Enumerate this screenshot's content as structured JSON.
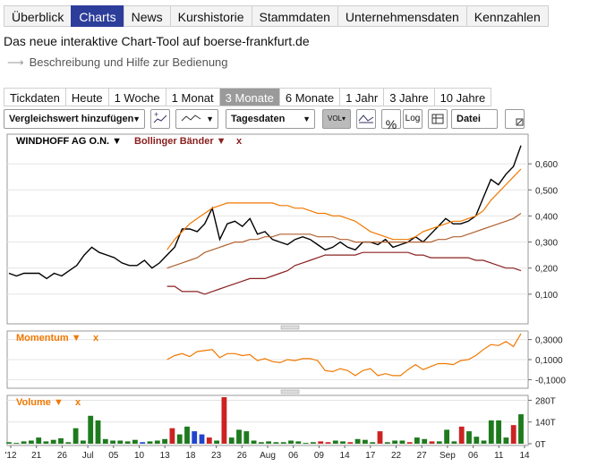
{
  "nav": {
    "tabs": [
      {
        "label": "Überblick",
        "active": false
      },
      {
        "label": "Charts",
        "active": true
      },
      {
        "label": "News",
        "active": false
      },
      {
        "label": "Kurshistorie",
        "active": false
      },
      {
        "label": "Stammdaten",
        "active": false
      },
      {
        "label": "Unternehmensdaten",
        "active": false
      },
      {
        "label": "Kennzahlen",
        "active": false
      }
    ]
  },
  "intro_text": "Das neue interaktive Chart-Tool auf boerse-frankfurt.de",
  "help_link": "Beschreibung und Hilfe zur Bedienung",
  "periods": [
    "Tickdaten",
    "Heute",
    "1 Woche",
    "1 Monat",
    "3 Monate",
    "6 Monate",
    "1 Jahr",
    "3 Jahre",
    "10 Jahre"
  ],
  "active_period": "3 Monate",
  "toolbar": {
    "compare_label": "Vergleichswert hinzufügen",
    "data_select": "Tagesdaten",
    "vol_label": "VOL",
    "log_label": "Log",
    "percent_label": "%",
    "file_label": "Datei"
  },
  "colors": {
    "accent": "#2c3d9a",
    "price": "#000000",
    "band_orange": "#f07800",
    "band_dark": "#8b2020",
    "mid": "#b06030",
    "up": "#1e7a1e",
    "down": "#cc2222",
    "neutral": "#2244cc"
  },
  "chart_data": [
    {
      "type": "line",
      "panel": "price",
      "legend": [
        "WINDHOFF AG O.N.",
        "Bollinger Bänder"
      ],
      "close_label": "x",
      "ylim": [
        0,
        0.7
      ],
      "yticks": [
        "0,100",
        "0,200",
        "0,300",
        "0,400",
        "0,500",
        "0,600"
      ],
      "series": [
        {
          "name": "WINDHOFF AG O.N.",
          "values": [
            0.18,
            0.17,
            0.18,
            0.18,
            0.18,
            0.16,
            0.18,
            0.17,
            0.19,
            0.21,
            0.25,
            0.28,
            0.26,
            0.25,
            0.24,
            0.22,
            0.21,
            0.21,
            0.23,
            0.2,
            0.22,
            0.25,
            0.28,
            0.35,
            0.35,
            0.34,
            0.37,
            0.43,
            0.31,
            0.37,
            0.38,
            0.36,
            0.39,
            0.33,
            0.34,
            0.31,
            0.3,
            0.29,
            0.31,
            0.32,
            0.31,
            0.29,
            0.27,
            0.28,
            0.3,
            0.28,
            0.27,
            0.3,
            0.3,
            0.29,
            0.31,
            0.28,
            0.29,
            0.3,
            0.32,
            0.3,
            0.33,
            0.36,
            0.39,
            0.37,
            0.37,
            0.38,
            0.4,
            0.47,
            0.54,
            0.52,
            0.56,
            0.59,
            0.67
          ]
        },
        {
          "name": "Upper band",
          "values": [
            null,
            null,
            null,
            null,
            null,
            null,
            null,
            null,
            null,
            null,
            null,
            null,
            null,
            null,
            null,
            null,
            null,
            null,
            null,
            null,
            null,
            0.27,
            0.31,
            0.34,
            0.37,
            0.39,
            0.41,
            0.43,
            0.44,
            0.45,
            0.45,
            0.45,
            0.45,
            0.45,
            0.45,
            0.45,
            0.44,
            0.44,
            0.43,
            0.43,
            0.42,
            0.41,
            0.41,
            0.4,
            0.4,
            0.39,
            0.38,
            0.36,
            0.34,
            0.33,
            0.32,
            0.31,
            0.31,
            0.31,
            0.32,
            0.34,
            0.35,
            0.36,
            0.37,
            0.38,
            0.38,
            0.39,
            0.4,
            0.42,
            0.46,
            0.49,
            0.52,
            0.55,
            0.58
          ]
        },
        {
          "name": "Middle band",
          "values": [
            null,
            null,
            null,
            null,
            null,
            null,
            null,
            null,
            null,
            null,
            null,
            null,
            null,
            null,
            null,
            null,
            null,
            null,
            null,
            null,
            null,
            0.2,
            0.21,
            0.22,
            0.23,
            0.24,
            0.26,
            0.27,
            0.28,
            0.29,
            0.3,
            0.3,
            0.31,
            0.31,
            0.32,
            0.32,
            0.33,
            0.33,
            0.33,
            0.33,
            0.33,
            0.32,
            0.32,
            0.32,
            0.31,
            0.31,
            0.3,
            0.3,
            0.3,
            0.3,
            0.3,
            0.3,
            0.3,
            0.3,
            0.3,
            0.3,
            0.3,
            0.31,
            0.31,
            0.32,
            0.32,
            0.33,
            0.34,
            0.35,
            0.36,
            0.37,
            0.38,
            0.39,
            0.41
          ]
        },
        {
          "name": "Lower band",
          "values": [
            null,
            null,
            null,
            null,
            null,
            null,
            null,
            null,
            null,
            null,
            null,
            null,
            null,
            null,
            null,
            null,
            null,
            null,
            null,
            null,
            null,
            0.13,
            0.13,
            0.11,
            0.11,
            0.11,
            0.1,
            0.11,
            0.12,
            0.13,
            0.14,
            0.15,
            0.16,
            0.16,
            0.16,
            0.17,
            0.18,
            0.19,
            0.21,
            0.22,
            0.23,
            0.24,
            0.25,
            0.25,
            0.25,
            0.25,
            0.25,
            0.26,
            0.26,
            0.26,
            0.26,
            0.26,
            0.26,
            0.26,
            0.25,
            0.25,
            0.24,
            0.24,
            0.24,
            0.24,
            0.24,
            0.24,
            0.23,
            0.23,
            0.22,
            0.21,
            0.2,
            0.2,
            0.19
          ]
        }
      ]
    },
    {
      "type": "line",
      "panel": "momentum",
      "legend": [
        "Momentum"
      ],
      "close_label": "x",
      "ylim": [
        -0.15,
        0.35
      ],
      "yticks": [
        "-0,1000",
        "0,1000",
        "0,3000"
      ],
      "series": [
        {
          "name": "Momentum",
          "values": [
            null,
            null,
            null,
            null,
            null,
            null,
            null,
            null,
            null,
            null,
            null,
            null,
            null,
            null,
            null,
            null,
            null,
            null,
            null,
            null,
            null,
            0.1,
            0.14,
            0.16,
            0.13,
            0.18,
            0.19,
            0.2,
            0.12,
            0.16,
            0.16,
            0.14,
            0.15,
            0.09,
            0.11,
            0.08,
            0.07,
            0.1,
            0.09,
            0.11,
            0.11,
            0.09,
            -0.01,
            -0.02,
            0.01,
            -0.01,
            -0.06,
            -0.01,
            0.01,
            -0.06,
            -0.04,
            -0.06,
            -0.06,
            0.0,
            0.05,
            0.0,
            0.03,
            0.06,
            0.06,
            0.05,
            0.09,
            0.1,
            0.14,
            0.2,
            0.25,
            0.24,
            0.28,
            0.23,
            0.36
          ]
        }
      ]
    },
    {
      "type": "bar",
      "panel": "volume",
      "legend": [
        "Volume"
      ],
      "close_label": "x",
      "ylim": [
        0,
        300
      ],
      "yticks": [
        "0T",
        "140T",
        "280T"
      ],
      "values": [
        10,
        5,
        15,
        20,
        40,
        15,
        25,
        35,
        10,
        100,
        20,
        180,
        150,
        30,
        20,
        20,
        15,
        25,
        10,
        15,
        20,
        30,
        100,
        60,
        110,
        80,
        60,
        40,
        20,
        300,
        40,
        90,
        80,
        20,
        10,
        15,
        10,
        10,
        20,
        15,
        5,
        10,
        15,
        10,
        20,
        15,
        10,
        30,
        25,
        10,
        80,
        10,
        20,
        20,
        10,
        40,
        30,
        15,
        15,
        90,
        15,
        110,
        80,
        45,
        20,
        150,
        150,
        40,
        120,
        190
      ],
      "direction": [
        "u",
        "u",
        "u",
        "u",
        "u",
        "u",
        "u",
        "u",
        "u",
        "u",
        "u",
        "u",
        "u",
        "u",
        "u",
        "u",
        "u",
        "u",
        "n",
        "u",
        "u",
        "u",
        "d",
        "u",
        "u",
        "n",
        "n",
        "d",
        "u",
        "d",
        "u",
        "u",
        "u",
        "u",
        "u",
        "u",
        "u",
        "u",
        "u",
        "u",
        "u",
        "u",
        "d",
        "d",
        "u",
        "u",
        "d",
        "u",
        "u",
        "u",
        "d",
        "u",
        "u",
        "u",
        "d",
        "u",
        "u",
        "d",
        "u",
        "u",
        "u",
        "d",
        "u",
        "u",
        "u",
        "u",
        "u",
        "u",
        "d",
        "u"
      ]
    }
  ],
  "x_axis_labels": [
    "'12",
    "21",
    "26",
    "Jul",
    "05",
    "10",
    "13",
    "18",
    "23",
    "26",
    "Aug",
    "06",
    "09",
    "14",
    "17",
    "22",
    "27",
    "Sep",
    "06",
    "11",
    "14"
  ]
}
